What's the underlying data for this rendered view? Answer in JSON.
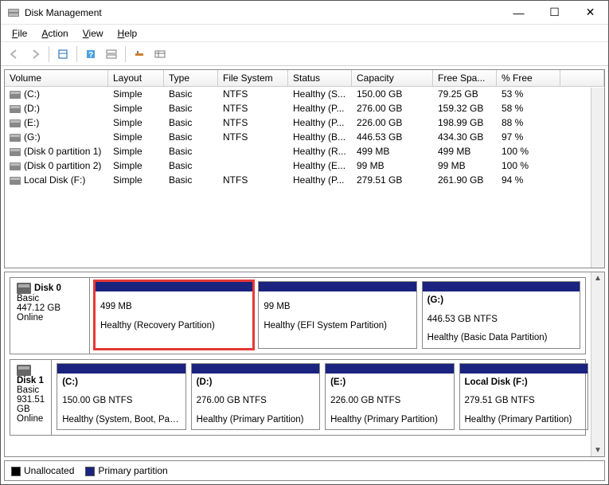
{
  "window": {
    "title": "Disk Management"
  },
  "menu": {
    "file": "File",
    "action": "Action",
    "view": "View",
    "help": "Help"
  },
  "columns": [
    "Volume",
    "Layout",
    "Type",
    "File System",
    "Status",
    "Capacity",
    "Free Spa...",
    "% Free"
  ],
  "volumes": [
    {
      "name": "(C:)",
      "layout": "Simple",
      "dtype": "Basic",
      "fs": "NTFS",
      "status": "Healthy (S...",
      "capacity": "150.00 GB",
      "free": "79.25 GB",
      "pct": "53 %"
    },
    {
      "name": "(D:)",
      "layout": "Simple",
      "dtype": "Basic",
      "fs": "NTFS",
      "status": "Healthy (P...",
      "capacity": "276.00 GB",
      "free": "159.32 GB",
      "pct": "58 %"
    },
    {
      "name": "(E:)",
      "layout": "Simple",
      "dtype": "Basic",
      "fs": "NTFS",
      "status": "Healthy (P...",
      "capacity": "226.00 GB",
      "free": "198.99 GB",
      "pct": "88 %"
    },
    {
      "name": "(G:)",
      "layout": "Simple",
      "dtype": "Basic",
      "fs": "NTFS",
      "status": "Healthy (B...",
      "capacity": "446.53 GB",
      "free": "434.30 GB",
      "pct": "97 %"
    },
    {
      "name": "(Disk 0 partition 1)",
      "layout": "Simple",
      "dtype": "Basic",
      "fs": "",
      "status": "Healthy (R...",
      "capacity": "499 MB",
      "free": "499 MB",
      "pct": "100 %"
    },
    {
      "name": "(Disk 0 partition 2)",
      "layout": "Simple",
      "dtype": "Basic",
      "fs": "",
      "status": "Healthy (E...",
      "capacity": "99 MB",
      "free": "99 MB",
      "pct": "100 %"
    },
    {
      "name": "Local Disk (F:)",
      "layout": "Simple",
      "dtype": "Basic",
      "fs": "NTFS",
      "status": "Healthy (P...",
      "capacity": "279.51 GB",
      "free": "261.90 GB",
      "pct": "94 %"
    }
  ],
  "disks": [
    {
      "name": "Disk 0",
      "dtype": "Basic",
      "size": "447.12 GB",
      "state": "Online",
      "parts": [
        {
          "title": "",
          "l2": "499 MB",
          "l3": "Healthy (Recovery Partition)",
          "highlight": true
        },
        {
          "title": "",
          "l2": "99 MB",
          "l3": "Healthy (EFI System Partition)"
        },
        {
          "title": "(G:)",
          "l2": "446.53 GB NTFS",
          "l3": "Healthy (Basic Data Partition)"
        }
      ]
    },
    {
      "name": "Disk 1",
      "dtype": "Basic",
      "size": "931.51 GB",
      "state": "Online",
      "parts": [
        {
          "title": "(C:)",
          "l2": "150.00 GB NTFS",
          "l3": "Healthy (System, Boot, Page File, ...)"
        },
        {
          "title": "(D:)",
          "l2": "276.00 GB NTFS",
          "l3": "Healthy (Primary Partition)"
        },
        {
          "title": "(E:)",
          "l2": "226.00 GB NTFS",
          "l3": "Healthy (Primary Partition)"
        },
        {
          "title": "Local Disk  (F:)",
          "l2": "279.51 GB NTFS",
          "l3": "Healthy (Primary Partition)"
        }
      ]
    }
  ],
  "legend": {
    "unalloc": "Unallocated",
    "primary": "Primary partition"
  }
}
